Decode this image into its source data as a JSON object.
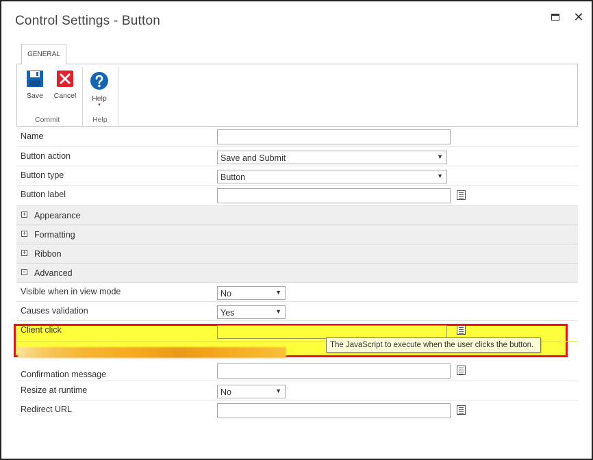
{
  "dialog": {
    "title": "Control Settings - Button",
    "close_glyph": "✕"
  },
  "tabs": [
    {
      "label": "GENERAL"
    }
  ],
  "ribbon": {
    "groups": [
      {
        "label": "Commit",
        "buttons": [
          {
            "label": "Save",
            "icon": "save-icon"
          },
          {
            "label": "Cancel",
            "icon": "cancel-icon"
          }
        ]
      },
      {
        "label": "Help",
        "buttons": [
          {
            "label": "Help",
            "icon": "help-icon"
          }
        ]
      }
    ],
    "chevron": "▾"
  },
  "form": {
    "name": {
      "label": "Name",
      "value": ""
    },
    "button_action": {
      "label": "Button action",
      "value": "Save and Submit"
    },
    "button_type": {
      "label": "Button type",
      "value": "Button"
    },
    "button_label": {
      "label": "Button label",
      "value": ""
    },
    "sections": [
      {
        "label": "Appearance",
        "toggle": "+"
      },
      {
        "label": "Formatting",
        "toggle": "+"
      },
      {
        "label": "Ribbon",
        "toggle": "+"
      },
      {
        "label": "Advanced",
        "toggle": "−"
      }
    ],
    "visible_view_mode": {
      "label": "Visible when in view mode",
      "value": "No"
    },
    "causes_validation": {
      "label": "Causes validation",
      "value": "Yes"
    },
    "client_click": {
      "label": "Client click",
      "value": "",
      "tooltip": "The JavaScript to execute when the user clicks the button."
    },
    "confirmation_message": {
      "label": "Confirmation message",
      "value": ""
    },
    "resize_runtime": {
      "label": "Resize at runtime",
      "value": "No"
    },
    "redirect_url": {
      "label": "Redirect URL",
      "value": ""
    }
  },
  "select_arrow": "▼",
  "colors": {
    "highlight": "#fdff3b",
    "highlight_border": "#e3141a",
    "save_blue": "#1565b7",
    "cancel_red": "#e2222a",
    "help_blue": "#1565b7"
  }
}
